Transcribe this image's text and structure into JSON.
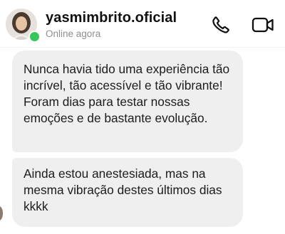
{
  "header": {
    "username": "yasmimbrito.oficial",
    "status": "Online agora",
    "icons": {
      "avatar": "profile-photo",
      "online_indicator": "green-dot",
      "call": "phone-icon",
      "video": "video-camera-icon"
    }
  },
  "messages": [
    {
      "lines": [
        "Nunca havia tido uma experiência tão incrível, tão acessível e tão vibrante!",
        "Foram dias para testar nossas emoções e de bastante evolução."
      ]
    },
    {
      "lines": [
        "Ainda estou anestesiada, mas na mesma vibração destes últimos dias kkkk"
      ]
    }
  ],
  "colors": {
    "bubble_bg": "#efefef",
    "online": "#34c759",
    "status_text": "#8e8e93"
  }
}
